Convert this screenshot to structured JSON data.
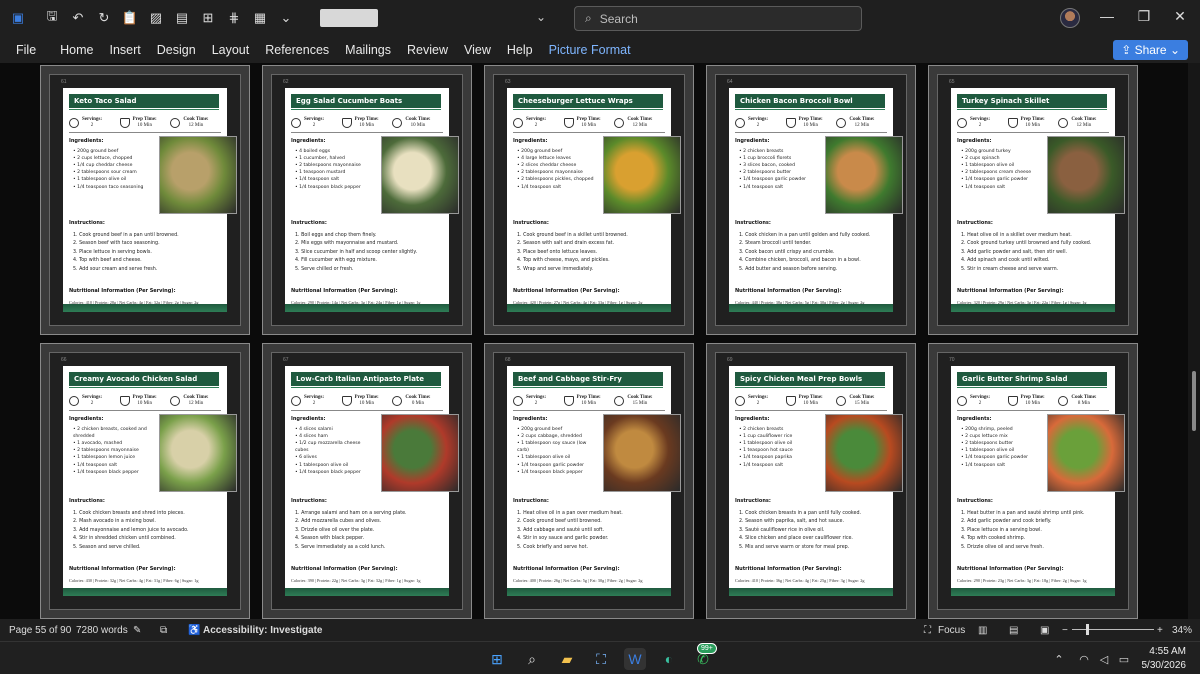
{
  "titlebar": {
    "title_chevron": "⌄",
    "search_placeholder": "Search",
    "minimize": "—",
    "restore": "❐",
    "close": "✕"
  },
  "menu": [
    "File",
    "Home",
    "Insert",
    "Design",
    "Layout",
    "References",
    "Mailings",
    "Review",
    "View",
    "Help",
    "Picture Format"
  ],
  "share_label": "Share",
  "recipes": [
    {
      "page": "61",
      "title": "Keto Taco Salad",
      "servings": "2",
      "prep": "10 Min",
      "cook": "12 Min",
      "ingredients": [
        "200g ground beef",
        "2 cups lettuce, chopped",
        "1/4 cup cheddar cheese",
        "2 tablespoons sour cream",
        "1 tablespoon olive oil",
        "1/4 teaspoon taco seasoning"
      ],
      "instructions": [
        "1. Cook ground beef in a pan until browned.",
        "2. Season beef with taco seasoning.",
        "3. Place lettuce in serving bowls.",
        "4. Top with beef and cheese.",
        "5. Add sour cream and serve fresh."
      ],
      "nutrition": "Calories: 410 | Protein: 28g | Net Carbs: 4g | Fat: 32g | Fiber: 2g | Sugar: 2g",
      "photo": [
        "#6f8a3a",
        "#b8a06a"
      ]
    },
    {
      "page": "62",
      "title": "Egg Salad Cucumber Boats",
      "servings": "2",
      "prep": "10 Min",
      "cook": "10 Min",
      "ingredients": [
        "4 boiled eggs",
        "1 cucumber, halved",
        "2 tablespoons mayonnaise",
        "1 teaspoon mustard",
        "1/4 teaspoon salt",
        "1/4 teaspoon black pepper"
      ],
      "instructions": [
        "1. Boil eggs and chop them finely.",
        "2. Mix eggs with mayonnaise and mustard.",
        "3. Slice cucumber in half and scoop center slightly.",
        "4. Fill cucumber with egg mixture.",
        "5. Serve chilled or fresh."
      ],
      "nutrition": "Calories: 290 | Protein: 14g | Net Carbs: 3g | Fat: 24g | Fiber: 1g | Sugar: 1g",
      "photo": [
        "#4d6b3a",
        "#e8e0c0"
      ]
    },
    {
      "page": "63",
      "title": "Cheeseburger Lettuce Wraps",
      "servings": "2",
      "prep": "10 Min",
      "cook": "12 Min",
      "ingredients": [
        "200g ground beef",
        "4 large lettuce leaves",
        "2 slices cheddar cheese",
        "2 tablespoons mayonnaise",
        "2 tablespoons pickles, chopped",
        "1/4 teaspoon salt"
      ],
      "instructions": [
        "1. Cook ground beef in a skillet until browned.",
        "2. Season with salt and drain excess fat.",
        "3. Place beef onto lettuce leaves.",
        "4. Top with cheese, mayo, and pickles.",
        "5. Wrap and serve immediately."
      ],
      "nutrition": "Calories: 420 | Protein: 27g | Net Carbs: 4g | Fat: 33g | Fiber: 1g | Sugar: 2g",
      "photo": [
        "#5b8a2a",
        "#d9a030"
      ]
    },
    {
      "page": "64",
      "title": "Chicken Bacon Broccoli Bowl",
      "servings": "2",
      "prep": "10 Min",
      "cook": "12 Min",
      "ingredients": [
        "2 chicken breasts",
        "1 cup broccoli florets",
        "3 slices bacon, cooked",
        "2 tablespoons butter",
        "1/4 teaspoon garlic powder",
        "1/4 teaspoon salt"
      ],
      "instructions": [
        "1. Cook chicken in a pan until golden and fully cooked.",
        "2. Steam broccoli until tender.",
        "3. Cook bacon until crispy and crumble.",
        "4. Combine chicken, broccoli, and bacon in a bowl.",
        "5. Add butter and season before serving."
      ],
      "nutrition": "Calories: 440 | Protein: 38g | Net Carbs: 5g | Fat: 30g | Fiber: 2g | Sugar: 2g",
      "photo": [
        "#3f7a2e",
        "#c98a4a"
      ]
    },
    {
      "page": "65",
      "title": "Turkey Spinach Skillet",
      "servings": "2",
      "prep": "10 Min",
      "cook": "12 Min",
      "ingredients": [
        "200g ground turkey",
        "2 cups spinach",
        "1 tablespoon olive oil",
        "2 tablespoons cream cheese",
        "1/4 teaspoon garlic powder",
        "1/4 teaspoon salt"
      ],
      "instructions": [
        "1. Heat olive oil in a skillet over medium heat.",
        "2. Cook ground turkey until browned and fully cooked.",
        "3. Add garlic powder and salt, then stir well.",
        "4. Add spinach and cook until wilted.",
        "5. Stir in cream cheese and serve warm."
      ],
      "nutrition": "Calories: 320 | Protein: 29g | Net Carbs: 3g | Fat: 22g | Fiber: 1g | Sugar: 1g",
      "photo": [
        "#3a5a28",
        "#8a6040"
      ]
    },
    {
      "page": "66",
      "title": "Creamy Avocado Chicken Salad",
      "servings": "2",
      "prep": "10 Min",
      "cook": "12 Min",
      "ingredients": [
        "2 chicken breasts, cooked and shredded",
        "1 avocado, mashed",
        "2 tablespoons mayonnaise",
        "1 tablespoon lemon juice",
        "1/4 teaspoon salt",
        "1/4 teaspoon black pepper"
      ],
      "instructions": [
        "1. Cook chicken breasts and shred into pieces.",
        "2. Mash avocado in a mixing bowl.",
        "3. Add mayonnaise and lemon juice to avocado.",
        "4. Stir in shredded chicken until combined.",
        "5. Season and serve chilled."
      ],
      "nutrition": "Calories: 430 | Protein: 32g | Net Carbs: 4g | Fat: 31g | Fiber: 6g | Sugar: 1g",
      "photo": [
        "#7aa04a",
        "#d8d0a8"
      ]
    },
    {
      "page": "67",
      "title": "Low-Carb Italian Antipasto Plate",
      "servings": "2",
      "prep": "10 Min",
      "cook": "0 Min",
      "ingredients": [
        "4 slices salami",
        "4 slices ham",
        "1/2 cup mozzarella cheese cubes",
        "6 olives",
        "1 tablespoon olive oil",
        "1/4 teaspoon black pepper"
      ],
      "instructions": [
        "1. Arrange salami and ham on a serving plate.",
        "2. Add mozzarella cubes and olives.",
        "3. Drizzle olive oil over the plate.",
        "4. Season with black pepper.",
        "5. Serve immediately as a cold lunch."
      ],
      "nutrition": "Calories: 390 | Protein: 22g | Net Carbs: 3g | Fat: 32g | Fiber: 1g | Sugar: 1g",
      "photo": [
        "#b03a2a",
        "#4a7a3a"
      ]
    },
    {
      "page": "68",
      "title": "Beef and Cabbage Stir-Fry",
      "servings": "2",
      "prep": "10 Min",
      "cook": "15 Min",
      "ingredients": [
        "200g ground beef",
        "2 cups cabbage, shredded",
        "1 tablespoon soy sauce (low carb)",
        "1 tablespoon olive oil",
        "1/4 teaspoon garlic powder",
        "1/4 teaspoon black pepper"
      ],
      "instructions": [
        "1. Heat olive oil in a pan over medium heat.",
        "2. Cook ground beef until browned.",
        "3. Add cabbage and sauté until soft.",
        "4. Stir in soy sauce and garlic powder.",
        "5. Cook briefly and serve hot."
      ],
      "nutrition": "Calories: 400 | Protein: 26g | Net Carbs: 5g | Fat: 30g | Fiber: 2g | Sugar: 2g",
      "photo": [
        "#6a3a20",
        "#c08a40"
      ]
    },
    {
      "page": "69",
      "title": "Spicy Chicken Meal Prep Bowls",
      "servings": "2",
      "prep": "10 Min",
      "cook": "15 Min",
      "ingredients": [
        "2 chicken breasts",
        "1 cup cauliflower rice",
        "1 tablespoon olive oil",
        "1 teaspoon hot sauce",
        "1/4 teaspoon paprika",
        "1/4 teaspoon salt"
      ],
      "instructions": [
        "1. Cook chicken breasts in a pan until fully cooked.",
        "2. Season with paprika, salt, and hot sauce.",
        "3. Sauté cauliflower rice in olive oil.",
        "4. Slice chicken and place over cauliflower rice.",
        "5. Mix and serve warm or store for meal prep."
      ],
      "nutrition": "Calories: 410 | Protein: 36g | Net Carbs: 4g | Fat: 25g | Fiber: 3g | Sugar: 2g",
      "photo": [
        "#b84a20",
        "#4a8a3a"
      ]
    },
    {
      "page": "70",
      "title": "Garlic Butter Shrimp Salad",
      "servings": "2",
      "prep": "10 Min",
      "cook": "8 Min",
      "ingredients": [
        "200g shrimp, peeled",
        "2 cups lettuce mix",
        "2 tablespoons butter",
        "1 tablespoon olive oil",
        "1/4 teaspoon garlic powder",
        "1/4 teaspoon salt"
      ],
      "instructions": [
        "1. Heat butter in a pan and sauté shrimp until pink.",
        "2. Add garlic powder and cook briefly.",
        "3. Place lettuce in a serving bowl.",
        "4. Top with cooked shrimp.",
        "5. Drizzle olive oil and serve fresh."
      ],
      "nutrition": "Calories: 290 | Protein: 23g | Net Carbs: 3g | Fat: 18g | Fiber: 2g | Sugar: 1g",
      "photo": [
        "#d86a3a",
        "#6aa03a"
      ]
    }
  ],
  "labels": {
    "servings": "Servings:",
    "prep": "Prep Time:",
    "cook": "Cook Time:",
    "ingredients": "Ingredients:",
    "instructions": "Instructions:",
    "nutrition": "Nutritional Information (Per Serving):"
  },
  "status": {
    "page": "Page 55 of 90",
    "words": "7280 words",
    "accessibility": "Accessibility: Investigate",
    "focus": "Focus",
    "zoom_minus": "−",
    "zoom_plus": "+",
    "zoom": "34%"
  },
  "taskbar": {
    "time": "4:55 AM",
    "date": "5/30/2026",
    "badge": "99+",
    "chevron": "⌃",
    "icons": [
      "windows-start-icon",
      "search-icon",
      "file-explorer-icon",
      "store-icon",
      "word-icon",
      "edge-icon",
      "whatsapp-icon"
    ]
  },
  "colors": {
    "accent": "#3b7ee0",
    "recipe_green": "#1f5a3f",
    "picture_format": "#7fb6ff"
  }
}
